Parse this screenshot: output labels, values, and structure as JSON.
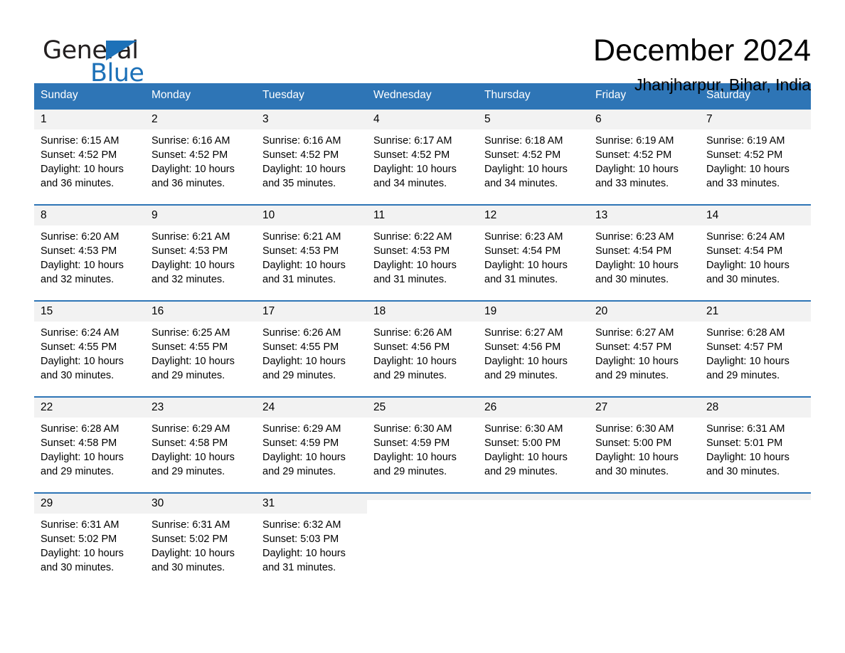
{
  "brand": {
    "name_dark": "General",
    "name_blue": "Blue",
    "triangle_color": "#1d71b8"
  },
  "header": {
    "month_title": "December 2024",
    "location": "Jhanjharpur, Bihar, India"
  },
  "theme": {
    "header_blue": "#2e75b6",
    "daynum_band": "#f2f2f2",
    "text": "#000000",
    "header_text": "#ffffff"
  },
  "calendar": {
    "weekday_headers": [
      "Sunday",
      "Monday",
      "Tuesday",
      "Wednesday",
      "Thursday",
      "Friday",
      "Saturday"
    ],
    "weeks": [
      [
        {
          "day": "1",
          "sunrise": "Sunrise: 6:15 AM",
          "sunset": "Sunset: 4:52 PM",
          "daylight_line1": "Daylight: 10 hours",
          "daylight_line2": "and 36 minutes."
        },
        {
          "day": "2",
          "sunrise": "Sunrise: 6:16 AM",
          "sunset": "Sunset: 4:52 PM",
          "daylight_line1": "Daylight: 10 hours",
          "daylight_line2": "and 36 minutes."
        },
        {
          "day": "3",
          "sunrise": "Sunrise: 6:16 AM",
          "sunset": "Sunset: 4:52 PM",
          "daylight_line1": "Daylight: 10 hours",
          "daylight_line2": "and 35 minutes."
        },
        {
          "day": "4",
          "sunrise": "Sunrise: 6:17 AM",
          "sunset": "Sunset: 4:52 PM",
          "daylight_line1": "Daylight: 10 hours",
          "daylight_line2": "and 34 minutes."
        },
        {
          "day": "5",
          "sunrise": "Sunrise: 6:18 AM",
          "sunset": "Sunset: 4:52 PM",
          "daylight_line1": "Daylight: 10 hours",
          "daylight_line2": "and 34 minutes."
        },
        {
          "day": "6",
          "sunrise": "Sunrise: 6:19 AM",
          "sunset": "Sunset: 4:52 PM",
          "daylight_line1": "Daylight: 10 hours",
          "daylight_line2": "and 33 minutes."
        },
        {
          "day": "7",
          "sunrise": "Sunrise: 6:19 AM",
          "sunset": "Sunset: 4:52 PM",
          "daylight_line1": "Daylight: 10 hours",
          "daylight_line2": "and 33 minutes."
        }
      ],
      [
        {
          "day": "8",
          "sunrise": "Sunrise: 6:20 AM",
          "sunset": "Sunset: 4:53 PM",
          "daylight_line1": "Daylight: 10 hours",
          "daylight_line2": "and 32 minutes."
        },
        {
          "day": "9",
          "sunrise": "Sunrise: 6:21 AM",
          "sunset": "Sunset: 4:53 PM",
          "daylight_line1": "Daylight: 10 hours",
          "daylight_line2": "and 32 minutes."
        },
        {
          "day": "10",
          "sunrise": "Sunrise: 6:21 AM",
          "sunset": "Sunset: 4:53 PM",
          "daylight_line1": "Daylight: 10 hours",
          "daylight_line2": "and 31 minutes."
        },
        {
          "day": "11",
          "sunrise": "Sunrise: 6:22 AM",
          "sunset": "Sunset: 4:53 PM",
          "daylight_line1": "Daylight: 10 hours",
          "daylight_line2": "and 31 minutes."
        },
        {
          "day": "12",
          "sunrise": "Sunrise: 6:23 AM",
          "sunset": "Sunset: 4:54 PM",
          "daylight_line1": "Daylight: 10 hours",
          "daylight_line2": "and 31 minutes."
        },
        {
          "day": "13",
          "sunrise": "Sunrise: 6:23 AM",
          "sunset": "Sunset: 4:54 PM",
          "daylight_line1": "Daylight: 10 hours",
          "daylight_line2": "and 30 minutes."
        },
        {
          "day": "14",
          "sunrise": "Sunrise: 6:24 AM",
          "sunset": "Sunset: 4:54 PM",
          "daylight_line1": "Daylight: 10 hours",
          "daylight_line2": "and 30 minutes."
        }
      ],
      [
        {
          "day": "15",
          "sunrise": "Sunrise: 6:24 AM",
          "sunset": "Sunset: 4:55 PM",
          "daylight_line1": "Daylight: 10 hours",
          "daylight_line2": "and 30 minutes."
        },
        {
          "day": "16",
          "sunrise": "Sunrise: 6:25 AM",
          "sunset": "Sunset: 4:55 PM",
          "daylight_line1": "Daylight: 10 hours",
          "daylight_line2": "and 29 minutes."
        },
        {
          "day": "17",
          "sunrise": "Sunrise: 6:26 AM",
          "sunset": "Sunset: 4:55 PM",
          "daylight_line1": "Daylight: 10 hours",
          "daylight_line2": "and 29 minutes."
        },
        {
          "day": "18",
          "sunrise": "Sunrise: 6:26 AM",
          "sunset": "Sunset: 4:56 PM",
          "daylight_line1": "Daylight: 10 hours",
          "daylight_line2": "and 29 minutes."
        },
        {
          "day": "19",
          "sunrise": "Sunrise: 6:27 AM",
          "sunset": "Sunset: 4:56 PM",
          "daylight_line1": "Daylight: 10 hours",
          "daylight_line2": "and 29 minutes."
        },
        {
          "day": "20",
          "sunrise": "Sunrise: 6:27 AM",
          "sunset": "Sunset: 4:57 PM",
          "daylight_line1": "Daylight: 10 hours",
          "daylight_line2": "and 29 minutes."
        },
        {
          "day": "21",
          "sunrise": "Sunrise: 6:28 AM",
          "sunset": "Sunset: 4:57 PM",
          "daylight_line1": "Daylight: 10 hours",
          "daylight_line2": "and 29 minutes."
        }
      ],
      [
        {
          "day": "22",
          "sunrise": "Sunrise: 6:28 AM",
          "sunset": "Sunset: 4:58 PM",
          "daylight_line1": "Daylight: 10 hours",
          "daylight_line2": "and 29 minutes."
        },
        {
          "day": "23",
          "sunrise": "Sunrise: 6:29 AM",
          "sunset": "Sunset: 4:58 PM",
          "daylight_line1": "Daylight: 10 hours",
          "daylight_line2": "and 29 minutes."
        },
        {
          "day": "24",
          "sunrise": "Sunrise: 6:29 AM",
          "sunset": "Sunset: 4:59 PM",
          "daylight_line1": "Daylight: 10 hours",
          "daylight_line2": "and 29 minutes."
        },
        {
          "day": "25",
          "sunrise": "Sunrise: 6:30 AM",
          "sunset": "Sunset: 4:59 PM",
          "daylight_line1": "Daylight: 10 hours",
          "daylight_line2": "and 29 minutes."
        },
        {
          "day": "26",
          "sunrise": "Sunrise: 6:30 AM",
          "sunset": "Sunset: 5:00 PM",
          "daylight_line1": "Daylight: 10 hours",
          "daylight_line2": "and 29 minutes."
        },
        {
          "day": "27",
          "sunrise": "Sunrise: 6:30 AM",
          "sunset": "Sunset: 5:00 PM",
          "daylight_line1": "Daylight: 10 hours",
          "daylight_line2": "and 30 minutes."
        },
        {
          "day": "28",
          "sunrise": "Sunrise: 6:31 AM",
          "sunset": "Sunset: 5:01 PM",
          "daylight_line1": "Daylight: 10 hours",
          "daylight_line2": "and 30 minutes."
        }
      ],
      [
        {
          "day": "29",
          "sunrise": "Sunrise: 6:31 AM",
          "sunset": "Sunset: 5:02 PM",
          "daylight_line1": "Daylight: 10 hours",
          "daylight_line2": "and 30 minutes."
        },
        {
          "day": "30",
          "sunrise": "Sunrise: 6:31 AM",
          "sunset": "Sunset: 5:02 PM",
          "daylight_line1": "Daylight: 10 hours",
          "daylight_line2": "and 30 minutes."
        },
        {
          "day": "31",
          "sunrise": "Sunrise: 6:32 AM",
          "sunset": "Sunset: 5:03 PM",
          "daylight_line1": "Daylight: 10 hours",
          "daylight_line2": "and 31 minutes."
        },
        {
          "day": "",
          "sunrise": "",
          "sunset": "",
          "daylight_line1": "",
          "daylight_line2": ""
        },
        {
          "day": "",
          "sunrise": "",
          "sunset": "",
          "daylight_line1": "",
          "daylight_line2": ""
        },
        {
          "day": "",
          "sunrise": "",
          "sunset": "",
          "daylight_line1": "",
          "daylight_line2": ""
        },
        {
          "day": "",
          "sunrise": "",
          "sunset": "",
          "daylight_line1": "",
          "daylight_line2": ""
        }
      ]
    ]
  }
}
